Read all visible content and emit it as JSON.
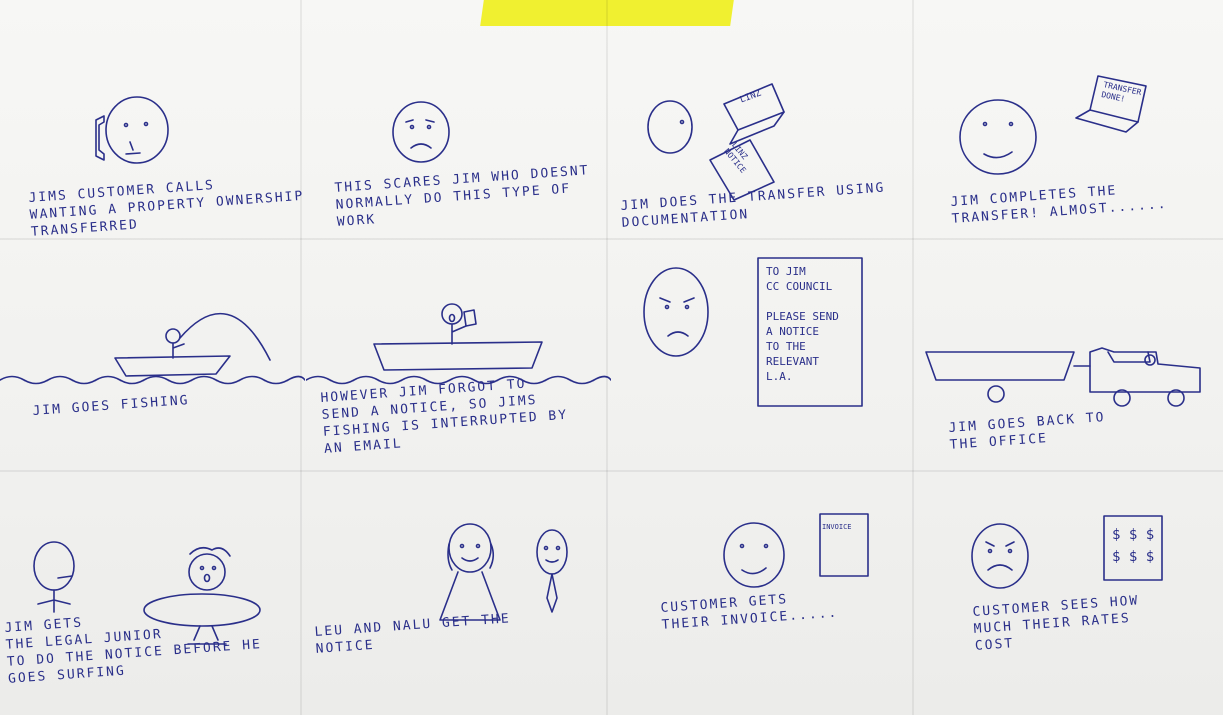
{
  "panels": [
    {
      "caption": "JIMS CUSTOMER CALLS\nWANTING A PROPERTY OWNERSHIP\nTRANSFERRED"
    },
    {
      "caption": "THIS SCARES JIM WHO DOESNT\nNORMALLY DO THIS TYPE OF\nWORK"
    },
    {
      "caption": "JIM DOES THE TRANSFER USING\nDOCUMENTATION",
      "laptop_label": "LINZ",
      "doc_label": "LINZ\nNOTICE"
    },
    {
      "caption": "JIM COMPLETES THE\nTRANSFER! ALMOST......",
      "laptop_label": "TRANSFER\nDONE!"
    },
    {
      "caption": "JIM GOES FISHING"
    },
    {
      "caption": "HOWEVER JIM FORGOT TO\nSEND A NOTICE, SO JIMS\nFISHING IS INTERRUPTED BY\nAN EMAIL"
    },
    {
      "caption": "",
      "note": "TO JIM\nCC COUNCIL\n\nPLEASE SEND\nA NOTICE\nTO THE\nRELEVANT\nL.A."
    },
    {
      "caption": "JIM GOES BACK TO\nTHE OFFICE"
    },
    {
      "caption": "JIM GETS\nTHE LEGAL JUNIOR\nTO DO THE NOTICE BEFORE HE\nGOES SURFING"
    },
    {
      "caption": "LEU AND NALU GET THE\nNOTICE"
    },
    {
      "caption": "CUSTOMER GETS\nTHEIR INVOICE.....",
      "invoice_label": "INVOICE"
    },
    {
      "caption": "CUSTOMER SEES HOW\nMUCH THEIR RATES\nCOST",
      "bill_label": "$ $ $\n$ $ $"
    }
  ]
}
